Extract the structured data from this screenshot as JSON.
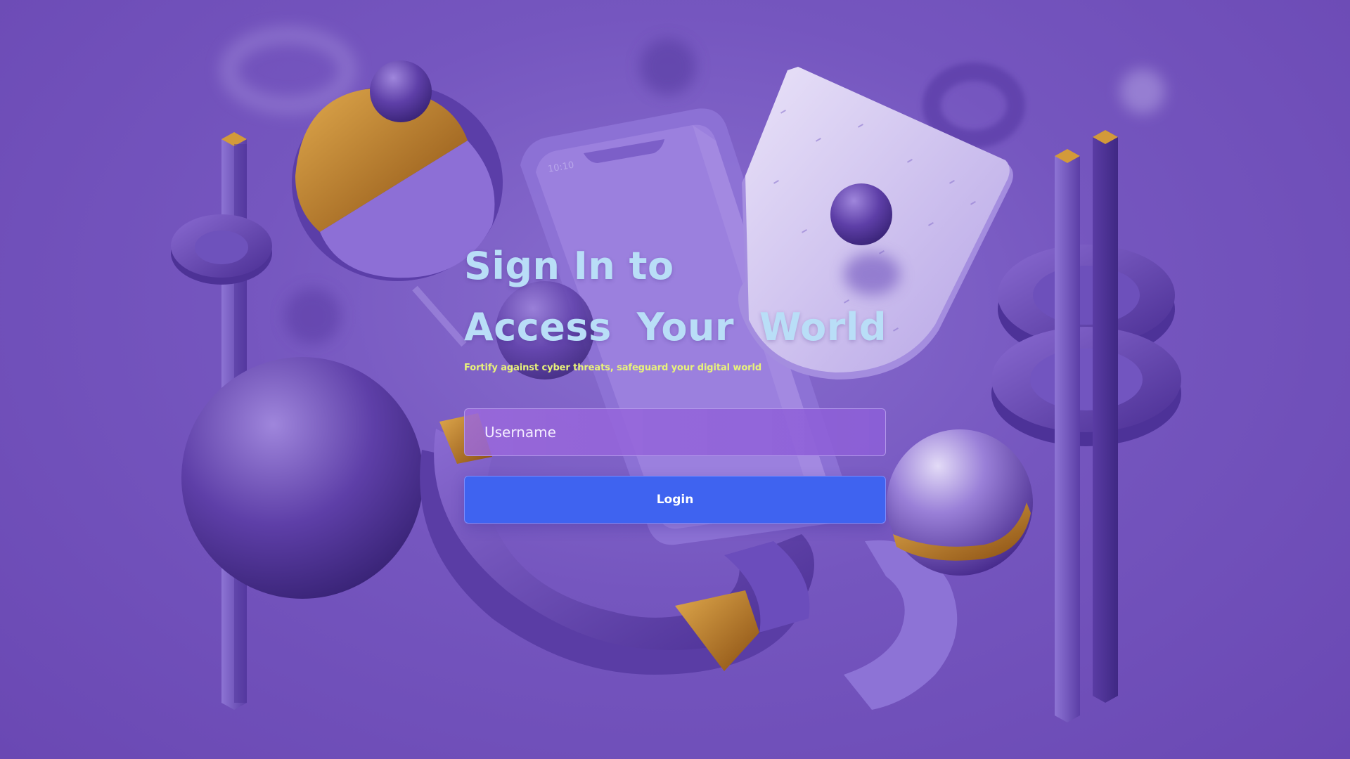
{
  "page": {
    "background_color": "#7556bf"
  },
  "hero": {
    "title_line1": "Sign In to",
    "title_words": [
      "Access",
      "Your",
      "World"
    ],
    "subtitle": "Fortify against cyber threats, safeguard your digital world"
  },
  "phone": {
    "status_time": "10:10"
  },
  "form": {
    "username": {
      "value": "",
      "placeholder": "Username"
    },
    "login_label": "Login"
  },
  "colors": {
    "title": "#b9def7",
    "subtitle": "#e8f27a",
    "login_button": "#3f63f0",
    "input_fill": "#9566d8",
    "gold_accent": "#c2852c"
  }
}
